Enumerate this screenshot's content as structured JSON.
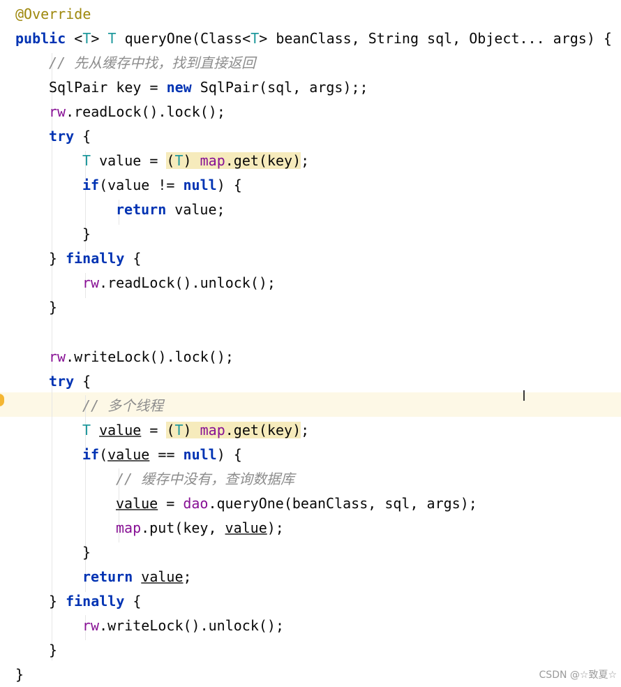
{
  "code": {
    "l01": {
      "annotation": "@Override"
    },
    "l02": {
      "kw_public": "public",
      "generic_open": " <",
      "type_param": "T",
      "generic_close": "> ",
      "ret_type": "T",
      "rest": " queryOne(Class<",
      "type_param2": "T",
      "rest2": "> beanClass, String sql, Object... args) {"
    },
    "l03": {
      "comment": "// 先从缓存中找，找到直接返回"
    },
    "l04": {
      "pre": "SqlPair key = ",
      "kw_new": "new",
      "post": " SqlPair(sql, args);;"
    },
    "l05": {
      "field": "rw",
      "post": ".readLock().lock();"
    },
    "l06": {
      "kw_try": "try",
      "post": " {"
    },
    "l07": {
      "type_param": "T",
      "mid": " value = ",
      "hl_open": "(",
      "hl_tp": "T",
      "hl_close": ") ",
      "hl_field": "map",
      "hl_call": ".get(key)",
      "end": ";"
    },
    "l08": {
      "kw_if": "if",
      "mid": "(value != ",
      "kw_null": "null",
      "post": ") {"
    },
    "l09": {
      "kw_return": "return",
      "post": " value;"
    },
    "l10": {
      "brace": "}"
    },
    "l11": {
      "pre": "} ",
      "kw_finally": "finally",
      "post": " {"
    },
    "l12": {
      "field": "rw",
      "post": ".readLock().unlock();"
    },
    "l13": {
      "brace": "}"
    },
    "l15": {
      "field": "rw",
      "post": ".writeLock().lock();"
    },
    "l16": {
      "kw_try": "try",
      "post": " {"
    },
    "l17": {
      "comment": "// 多个线程"
    },
    "l18": {
      "type_param": "T",
      "space": " ",
      "var": "value",
      "mid": " = ",
      "hl_open": "(",
      "hl_tp": "T",
      "hl_close": ") ",
      "hl_field": "map",
      "hl_call": ".get(key)",
      "end": ";"
    },
    "l19": {
      "kw_if": "if",
      "paren": "(",
      "var": "value",
      "mid": " == ",
      "kw_null": "null",
      "post": ") {"
    },
    "l20": {
      "comment": "// 缓存中没有，查询数据库"
    },
    "l21": {
      "var": "value",
      "mid": " = ",
      "field": "dao",
      "post": ".queryOne(beanClass, sql, args);"
    },
    "l22": {
      "field": "map",
      "mid": ".put(key, ",
      "var": "value",
      "post": ");"
    },
    "l23": {
      "brace": "}"
    },
    "l24": {
      "kw_return": "return",
      "space": " ",
      "var": "value",
      "post": ";"
    },
    "l25": {
      "pre": "} ",
      "kw_finally": "finally",
      "post": " {"
    },
    "l26": {
      "field": "rw",
      "post": ".writeLock().unlock();"
    },
    "l27": {
      "brace": "}"
    },
    "l28": {
      "brace": "}"
    }
  },
  "cursor_glyph": "I",
  "watermark": "CSDN @☆致夏☆",
  "colors": {
    "keyword": "#0033b3",
    "annotation": "#9e880d",
    "type_param": "#20999d",
    "field": "#871094",
    "comment": "#8c8c8c",
    "highlight": "#f6ebbc",
    "current_line": "#fdf8e6"
  }
}
